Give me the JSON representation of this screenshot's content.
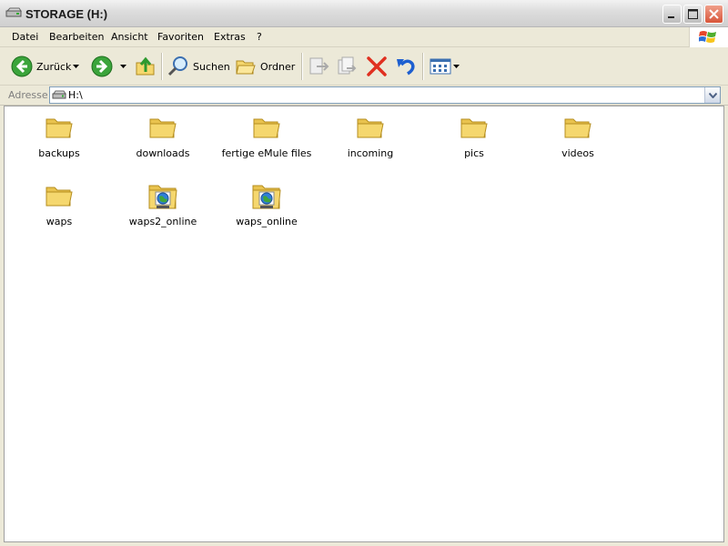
{
  "window": {
    "title": "STORAGE (H:)"
  },
  "menu": {
    "items": [
      "Datei",
      "Bearbeiten",
      "Ansicht",
      "Favoriten",
      "Extras",
      "?"
    ]
  },
  "toolbar": {
    "back_label": "Zurück",
    "search_label": "Suchen",
    "folders_label": "Ordner"
  },
  "address": {
    "label": "Adresse",
    "value": "H:\\"
  },
  "items": [
    {
      "name": "backups",
      "type": "folder"
    },
    {
      "name": "downloads",
      "type": "folder"
    },
    {
      "name": "fertige eMule files",
      "type": "folder"
    },
    {
      "name": "incoming",
      "type": "folder"
    },
    {
      "name": "pics",
      "type": "folder"
    },
    {
      "name": "videos",
      "type": "folder"
    },
    {
      "name": "waps",
      "type": "folder"
    },
    {
      "name": "waps2_online",
      "type": "shared-web-folder"
    },
    {
      "name": "waps_online",
      "type": "shared-web-folder"
    }
  ],
  "colors": {
    "folder": "#F5D76E",
    "close_button": "#D8553A",
    "back_arrow": "#3BA43B",
    "delete": "#E03020"
  }
}
